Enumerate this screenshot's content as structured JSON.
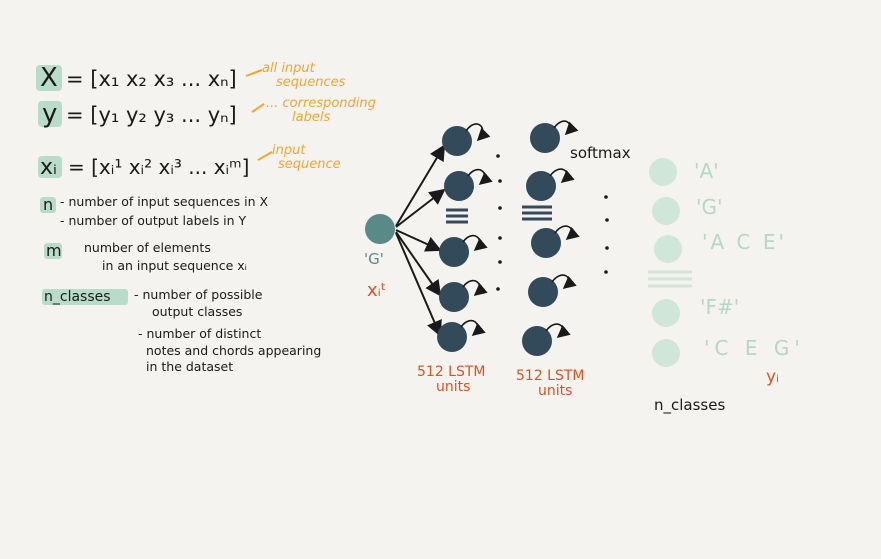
{
  "definitions": {
    "x_eq": {
      "lhs": "X",
      "rhs": "= [x₁ x₂ x₃ ... xₙ]",
      "note1": "all input",
      "note2": "sequences"
    },
    "y_eq": {
      "lhs": "y",
      "rhs": "= [y₁ y₂ y₃ ... yₙ]",
      "note1": "... corresponding",
      "note2": "labels"
    },
    "xi_eq": {
      "lhs": "xᵢ",
      "rhs": "= [xᵢ¹ xᵢ² xᵢ³ ... xᵢᵐ]",
      "note1": "input",
      "note2": "sequence"
    },
    "n_def": {
      "term": "n",
      "line1": "- number of input sequences in X",
      "line2": "- number of output labels in Y"
    },
    "m_def": {
      "term": "m",
      "line1": "number of elements",
      "line2": "in an input sequence xᵢ"
    },
    "nclasses_def": {
      "term": "n_classes",
      "line1": "- number of possible",
      "line2": "output classes",
      "line3": "- number of distinct",
      "line4": "notes and chords appearing",
      "line5": "in the dataset"
    }
  },
  "network": {
    "input_label": "'G'",
    "input_symbol": "xᵢᵗ",
    "layer1_label1": "512 LSTM",
    "layer1_label2": "units",
    "layer2_label1": "512 LSTM",
    "layer2_label2": "units",
    "softmax_label": "softmax",
    "output_labels": [
      "'A'",
      "'G'",
      "'A C E'",
      "'F#'",
      "'C E G'"
    ],
    "output_symbol": "yᵢ",
    "output_caption": "n_classes"
  },
  "colors": {
    "ink": "#1a1a1a",
    "annotation": "#f0a530",
    "unit_label": "#d9541e",
    "highlight": "#b8dcc9",
    "input_node": "#5a8a88",
    "lstm_node": "#334a5a",
    "output_node": "#cfe6d8",
    "output_text": "#b3d8c6"
  }
}
